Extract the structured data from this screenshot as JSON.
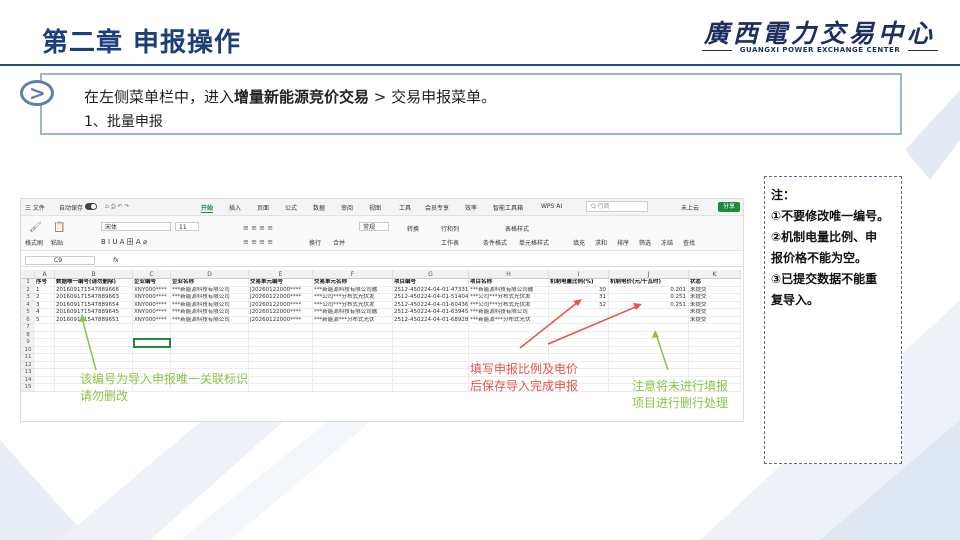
{
  "header": {
    "title": "第二章  申报操作",
    "logo_cn": "廣西電力交易中心",
    "logo_en": "GUANGXI POWER EXCHANGE CENTER"
  },
  "instruction": {
    "line1_prefix": "在左侧菜单栏中，进入",
    "line1_bold": "增量新能源竞价交易",
    "line1_suffix": " > 交易申报菜单。",
    "line2": "1、批量申报"
  },
  "notes": {
    "title": "注：",
    "items": [
      "①不要修改唯一编号。",
      "②机制电量比例、申",
      "报价格不能为空。",
      "③已提交数据不能重",
      "复导入。"
    ]
  },
  "spreadsheet": {
    "menu": [
      "三 文件",
      "自动保存",
      "开始",
      "插入",
      "页面",
      "公式",
      "数据",
      "审阅",
      "视图",
      "工具",
      "会员专享",
      "效率",
      "智能工具箱",
      "WPS AI"
    ],
    "search_placeholder": "Q 行商",
    "cloud_label": "未上云",
    "share_label": "分享",
    "ribbon": {
      "format_painter": "格式刷",
      "paste": "粘贴",
      "font_name": "宋体",
      "font_size": "11",
      "wrap": "换行",
      "merge": "合并",
      "number_format": "常规",
      "convert": "转换",
      "row_col": "行和列",
      "worksheet": "工作表",
      "cond_format": "条件格式",
      "table_style": "表格样式",
      "cell_style": "单元格样式",
      "fill": "填充",
      "sum": "求和",
      "sort": "排序",
      "filter": "筛选",
      "freeze": "冻结",
      "find": "查找"
    },
    "name_box": "C9",
    "fx": "fx",
    "columns": [
      "A",
      "B",
      "C",
      "D",
      "E",
      "F",
      "G",
      "H",
      "I",
      "J",
      "K"
    ],
    "headers": [
      "序号",
      "数据唯一编号(请勿删除)",
      "企业编号",
      "企业名称",
      "交易单元编号",
      "交易单元名称",
      "项目编号",
      "项目名称",
      "机制电量比例(%)",
      "机制电价(元/千瓦时)",
      "状态"
    ],
    "rows": [
      [
        "1",
        "201609171547889666",
        "XNY000****",
        "***新能源科技有限公司",
        "J20260122000****",
        "***新能源科技有限公司融",
        "2512-450224-04-01-47331",
        "***新能源科技有限公司融",
        "30",
        "0.201",
        "未提交"
      ],
      [
        "2",
        "201609171547889663",
        "XNY000****",
        "***新能源科技有限公司",
        "J20260122000****",
        "***公司***分布式光伏发",
        "2512-450224-04-01-51404",
        "***公司***分布式光伏发",
        "31",
        "0.251",
        "未提交"
      ],
      [
        "3",
        "201609171547889654",
        "XNY000****",
        "***新能源科技有限公司",
        "J20260122000****",
        "***公司***分布式光伏发",
        "2512-450224-04-01-60436",
        "***公司***分布式光伏发",
        "32",
        "0.251",
        "未提交"
      ],
      [
        "4",
        "201609171547889645",
        "XNY000****",
        "***新能源科技有限公司",
        "J20260122000****",
        "***新能源科技有限公司融",
        "2512-450224-04-01-63945",
        "***新能源科技有限公司",
        "",
        "",
        "未提交"
      ],
      [
        "5",
        "201609171547889651",
        "XNY000****",
        "***新能源科技有限公司",
        "J20260122000****",
        "***新能源***分布式光伏",
        "2512-450224-04-01-68928",
        "***新能源***分布式光伏",
        "",
        "",
        "未提交"
      ]
    ],
    "row_numbers": [
      "1",
      "2",
      "3",
      "4",
      "5",
      "6",
      "7",
      "8",
      "9",
      "10",
      "11",
      "12",
      "13",
      "14",
      "15"
    ]
  },
  "annotations": {
    "unique_id_note_1": "该编号为导入申报唯一关联标识",
    "unique_id_note_2": "请勿删改",
    "fill_note_1": "填写申报比例及电价",
    "fill_note_2": "后保存导入完成申报",
    "skip_note_1": "注意将未进行填报",
    "skip_note_2": "项目进行删行处理"
  },
  "colors": {
    "title": "#1d3e78",
    "accent_green": "#1d8a3c",
    "annotation_green": "#8bc34a",
    "annotation_red": "#e8534a"
  }
}
